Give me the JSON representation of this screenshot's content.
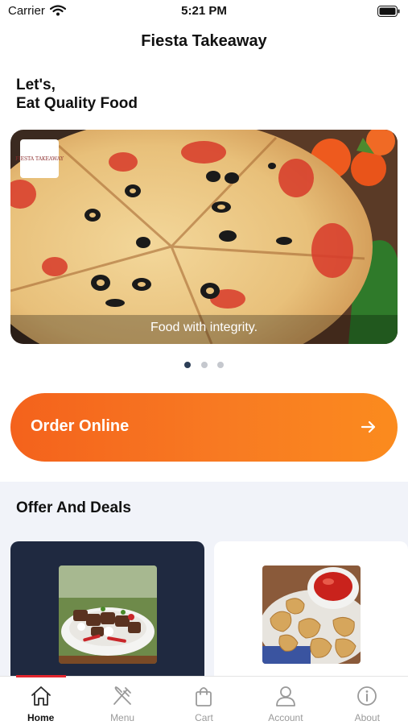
{
  "status_bar": {
    "carrier": "Carrier",
    "time": "5:21 PM"
  },
  "header": {
    "title": "Fiesta Takeaway"
  },
  "greeting": {
    "line1": "Let's,",
    "line2": "Eat Quality Food"
  },
  "hero": {
    "logo_text": "FIESTA TAKEAWAY",
    "caption": "Food with integrity.",
    "slide_count": 3,
    "active_slide": 1
  },
  "order_button": {
    "label": "Order Online",
    "icon": "arrow-right-icon"
  },
  "offers": {
    "title": "Offer And Deals"
  },
  "tabs": [
    {
      "label": "Home",
      "icon": "home-icon",
      "active": true
    },
    {
      "label": "Menu",
      "icon": "fork-knife-icon",
      "active": false
    },
    {
      "label": "Cart",
      "icon": "shopping-bag-icon",
      "active": false
    },
    {
      "label": "Account",
      "icon": "person-icon",
      "active": false
    },
    {
      "label": "About",
      "icon": "info-icon",
      "active": false
    }
  ],
  "colors": {
    "accent_start": "#f4621c",
    "accent_end": "#fb8b1e",
    "dark_card": "#1f2940",
    "tab_indicator": "#e3262e",
    "active_dot": "#2c3e57"
  }
}
